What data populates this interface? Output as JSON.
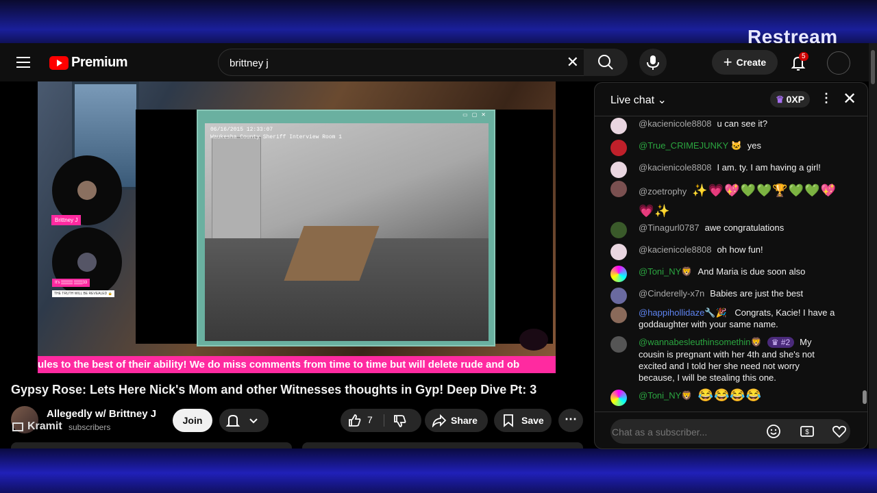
{
  "overlay": {
    "brand": "Restream"
  },
  "topbar": {
    "logo_text": "Premium",
    "search_value": "brittney j",
    "create_label": "Create",
    "notification_count": "5"
  },
  "video": {
    "timestamp_line1": "06/16/2015 12:33:07",
    "timestamp_line2": "Waukesha County Sheriff Interview Room 1",
    "guest1_tag": "Brittney J",
    "guest2_tag": "It's ▒▒▒▒ ▒▒▒33",
    "guest2_caption": "THE TRUTH WILL BE REVEALED 🔒",
    "ticker": "ules to the best of their ability! We do miss comments from time to time but will delete rude and ob"
  },
  "meta": {
    "title": "Gypsy Rose: Lets Here Nick's Mom and other Witnesses thoughts in Gyp! Deep Dive Pt: 3",
    "channel": "Allegedly w/ Brittney J",
    "subscribers": "subscribers",
    "overlay_label": "Kramit",
    "join_label": "Join",
    "like_count": "7",
    "share_label": "Share",
    "save_label": "Save"
  },
  "chat": {
    "title": "Live chat",
    "xp": "0XP",
    "input_placeholder": "Chat as a subscriber...",
    "messages": [
      {
        "author": "@kacienicole8808",
        "text": "u can see it?",
        "color": "gray"
      },
      {
        "author": "@True_CRIMEJUNKY 🐱",
        "text": "yes",
        "color": "green"
      },
      {
        "author": "@kacienicole8808",
        "text": "I am. ty. I am having a girl!",
        "color": "gray"
      },
      {
        "author": "@zoetrophy",
        "text": "✨💗💖💚💚🏆💚💚💖💗✨",
        "color": "gray"
      },
      {
        "author": "@Tinagurl0787",
        "text": "awe congratulations",
        "color": "gray"
      },
      {
        "author": "@kacienicole8808",
        "text": "oh how fun!",
        "color": "gray"
      },
      {
        "author": "@Toni_NY🦁",
        "text": "And Maria is due soon also",
        "color": "green"
      },
      {
        "author": "@Cinderelly-x7n",
        "text": "Babies are just the best",
        "color": "gray"
      },
      {
        "author": "@happihollidaze🔧🎉",
        "text": "Congrats, Kacie! I have a goddaughter with your same name.",
        "color": "blue"
      },
      {
        "author": "@wannabesleuthinsomethin🦁",
        "badge": "#2",
        "text": "My cousin is pregnant with her 4th and she's not excited and I told her she need not worry because, I will be stealing this one.",
        "color": "green"
      },
      {
        "author": "@Toni_NY🦁",
        "text": "😂😂😂😂",
        "color": "green"
      }
    ]
  }
}
